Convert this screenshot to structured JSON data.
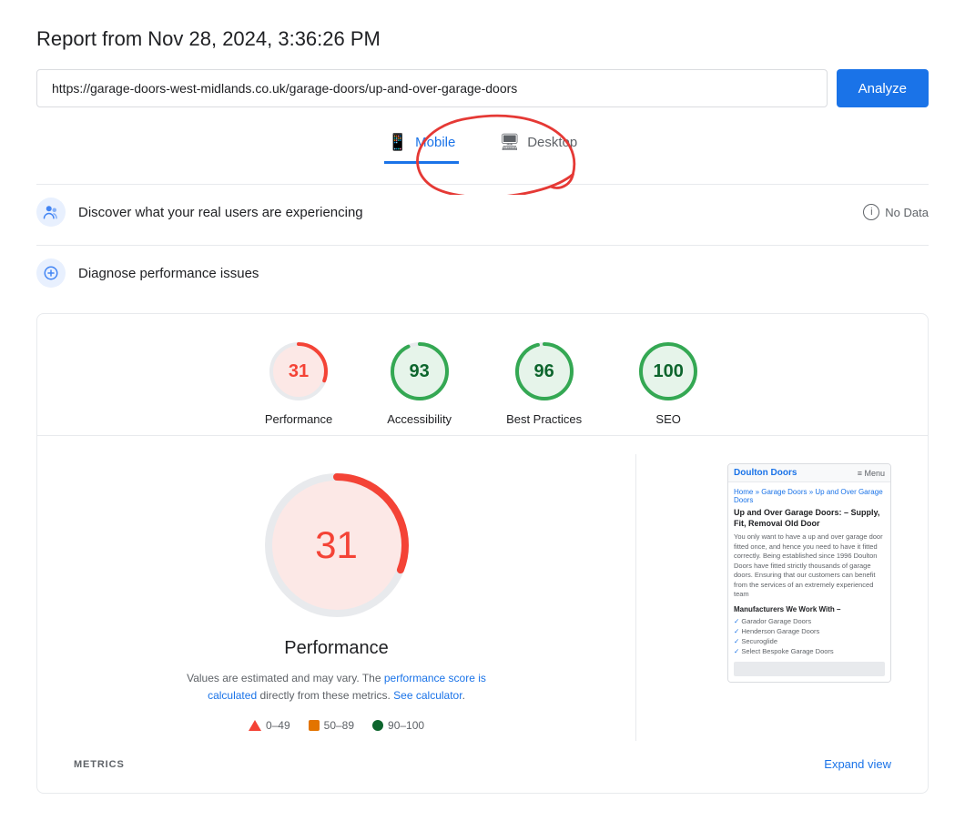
{
  "page": {
    "report_title": "Report from Nov 28, 2024, 3:36:26 PM",
    "url": "https://garage-doors-west-midlands.co.uk/garage-doors/up-and-over-garage-doors",
    "analyze_button": "Analyze",
    "device_tabs": [
      {
        "id": "mobile",
        "label": "Mobile",
        "active": true
      },
      {
        "id": "desktop",
        "label": "Desktop",
        "active": false
      }
    ],
    "real_users_section": {
      "label": "Discover what your real users are experiencing",
      "no_data_label": "No Data"
    },
    "diagnose_section": {
      "label": "Diagnose performance issues"
    },
    "scores": [
      {
        "id": "performance",
        "value": "31",
        "label": "Performance",
        "color": "#f44336",
        "bg": "#fce8e6",
        "stroke": "#f44336",
        "type": "red"
      },
      {
        "id": "accessibility",
        "value": "93",
        "label": "Accessibility",
        "color": "#0d652d",
        "bg": "#e6f4ea",
        "stroke": "#34a853",
        "type": "green"
      },
      {
        "id": "best-practices",
        "value": "96",
        "label": "Best Practices",
        "color": "#0d652d",
        "bg": "#e6f4ea",
        "stroke": "#34a853",
        "type": "green"
      },
      {
        "id": "seo",
        "value": "100",
        "label": "SEO",
        "color": "#0d652d",
        "bg": "#e6f4ea",
        "stroke": "#34a853",
        "type": "green"
      }
    ],
    "performance_detail": {
      "score": "31",
      "title": "Performance",
      "note_plain": "Values are estimated and may vary. The ",
      "note_link1": "performance score is calculated",
      "note_link1_href": "#",
      "note_mid": " directly from these metrics. ",
      "note_link2": "See calculator",
      "note_link2_href": "#",
      "note_end": "."
    },
    "legend": [
      {
        "type": "red",
        "range": "0–49"
      },
      {
        "type": "orange",
        "range": "50–89"
      },
      {
        "type": "green",
        "range": "90–100"
      }
    ],
    "metrics_bar": {
      "label": "METRICS",
      "expand_label": "Expand view"
    },
    "thumbnail": {
      "brand": "Doulton Doors",
      "menu": "≡ Menu",
      "breadcrumb": "Home » Garage Doors » Up and Over Garage Doors",
      "h1": "Up and Over Garage Doors: – Supply, Fit, Removal Old Door",
      "body_text": "You only want to have a up and over garage door fitted once, and hence you need to have it fitted correctly. Being established since 1996 Doulton Doors have fitted strictly thousands of garage doors. Ensuring that our customers can benefit from the services of an extremely experienced team",
      "section_title": "Manufacturers We Work With –",
      "list_items": [
        "Garador Garage Doors",
        "Henderson Garage Doors",
        "Securoglide",
        "Select Bespoke Garage Doors"
      ]
    }
  }
}
